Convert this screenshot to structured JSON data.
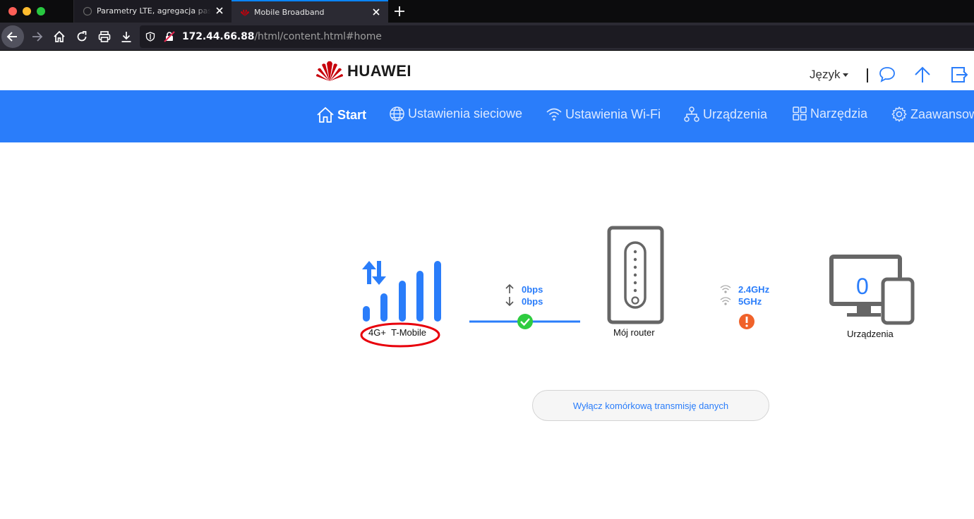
{
  "browser": {
    "tabs": [
      {
        "title": "Parametry LTE, agregacja pasm i siła sygnału",
        "active": false
      },
      {
        "title": "Mobile Broadband",
        "active": true
      }
    ],
    "url_host": "172.44.66.88",
    "url_path": "/html/content.html#home"
  },
  "header": {
    "logo_text": "HUAWEI",
    "language_label": "Język",
    "brand_color": "#c7000b"
  },
  "menu": {
    "accent": "#2a7dfa",
    "items": [
      {
        "label": "Start",
        "icon": "home-icon",
        "active": true
      },
      {
        "label": "Ustawienia sieciowe",
        "icon": "globe-icon"
      },
      {
        "label": "Ustawienia Wi-Fi",
        "icon": "wifi-icon"
      },
      {
        "label": "Urządzenia",
        "icon": "network-icon"
      },
      {
        "label": "Narzędzia",
        "icon": "grid-icon"
      },
      {
        "label": "Zaawansowane",
        "icon": "gear-icon"
      }
    ]
  },
  "status": {
    "network_type": "4G+",
    "operator": "T-Mobile",
    "upload_speed": "0bps",
    "download_speed": "0bps",
    "connection_ok_color": "#2ecc40",
    "router_label": "Mój router",
    "wifi_bands": [
      "2.4GHz",
      "5GHz"
    ],
    "wifi_warning_color": "#f0622a",
    "devices_count": "0",
    "devices_label": "Urządzenia",
    "highlight_color": "#e8000b"
  },
  "actions": {
    "mobile_data_button": "Wyłącz komórkową transmisję danych"
  }
}
